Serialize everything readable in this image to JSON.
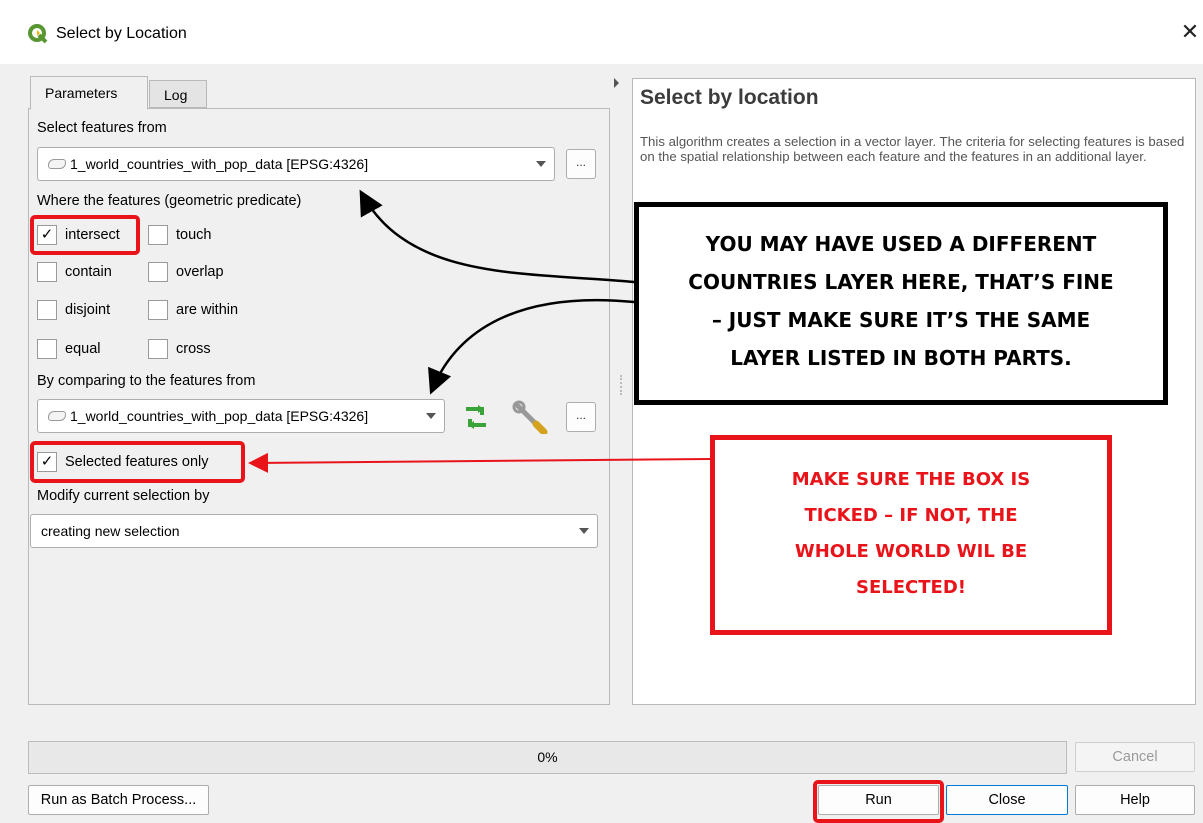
{
  "window": {
    "title": "Select by Location",
    "close_glyph": "✕"
  },
  "tabs": [
    {
      "label": "Parameters",
      "active": true
    },
    {
      "label": "Log",
      "active": false
    }
  ],
  "params": {
    "select_from_label": "Select features from",
    "select_from_value": "1_world_countries_with_pop_data [EPSG:4326]",
    "more_button": "...",
    "predicate_label": "Where the features (geometric predicate)",
    "predicates": [
      {
        "label": "intersect",
        "checked": true
      },
      {
        "label": "touch",
        "checked": false
      },
      {
        "label": "contain",
        "checked": false
      },
      {
        "label": "overlap",
        "checked": false
      },
      {
        "label": "disjoint",
        "checked": false
      },
      {
        "label": "are within",
        "checked": false
      },
      {
        "label": "equal",
        "checked": false
      },
      {
        "label": "cross",
        "checked": false
      }
    ],
    "compare_label": "By comparing to the features from",
    "compare_value": "1_world_countries_with_pop_data [EPSG:4326]",
    "selected_only_label": "Selected features only",
    "selected_only_checked": true,
    "modify_label": "Modify current selection by",
    "modify_value": "creating new selection"
  },
  "help": {
    "title": "Select by location",
    "text": "This algorithm creates a selection in a vector layer. The criteria for selecting features is based on the spatial relationship between each feature and the features in an additional layer."
  },
  "callouts": {
    "black_lines": [
      "YOU MAY HAVE USED A DIFFERENT",
      "COUNTRIES LAYER HERE, THAT’S FINE",
      "– JUST MAKE SURE IT’S THE SAME",
      "LAYER LISTED IN BOTH PARTS."
    ],
    "red_lines": [
      "MAKE SURE THE BOX IS",
      "TICKED – IF NOT, THE",
      "WHOLE WORLD WIL BE",
      "SELECTED!"
    ]
  },
  "progress": {
    "text": "0%",
    "value": 0
  },
  "buttons": {
    "cancel": "Cancel",
    "batch": "Run as Batch Process...",
    "run": "Run",
    "close": "Close",
    "help": "Help"
  },
  "colors": {
    "annotation_red": "#e8141a",
    "qgis_green": "#589632"
  }
}
